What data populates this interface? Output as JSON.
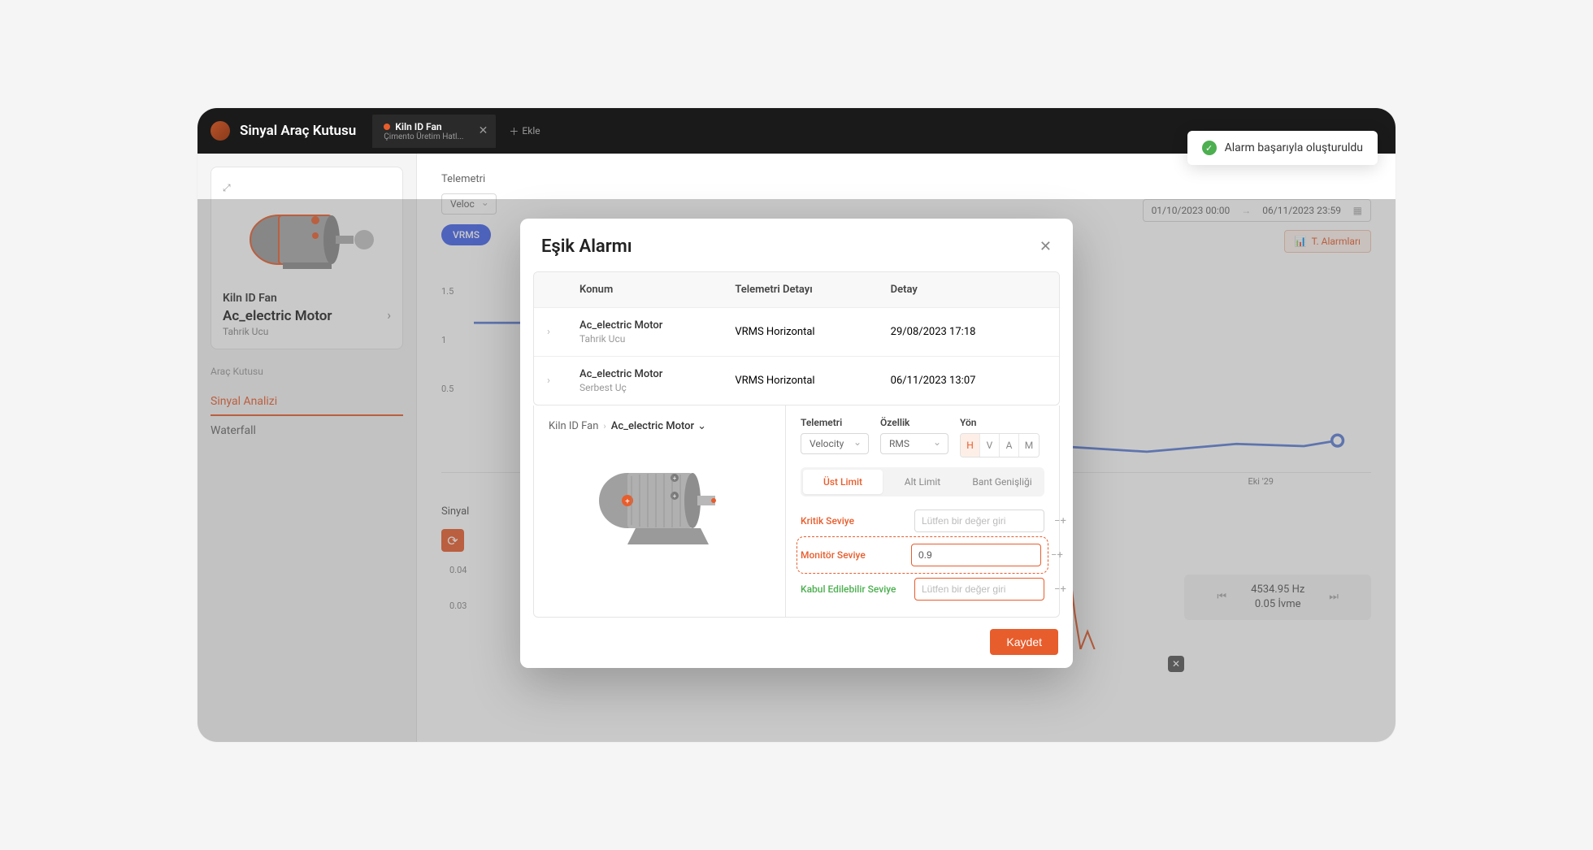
{
  "app": {
    "title": "Sinyal Araç Kutusu"
  },
  "tab": {
    "title": "Kiln ID Fan",
    "subtitle": "Çimento Üretim Hatl...",
    "add_label": "Ekle"
  },
  "toast": {
    "text": "Alarm başarıyla oluşturuldu"
  },
  "sidebar": {
    "card": {
      "line1": "Kiln ID Fan",
      "line2": "Ac_electric Motor",
      "line3": "Tahrik Ucu"
    },
    "section_label": "Araç Kutusu",
    "nav": {
      "signal_analysis": "Sinyal Analizi",
      "waterfall": "Waterfall"
    }
  },
  "content": {
    "telemetry_label": "Telemetri",
    "telemetry_select": "Veloc",
    "vrms_chip": "VRMS",
    "daterange": {
      "from": "01/10/2023 00:00",
      "to": "06/11/2023 23:59"
    },
    "alarms_btn": "T. Alarmları",
    "y_ticks": [
      "1.5",
      "1",
      "0.5"
    ],
    "x_tick": "Eki '29",
    "signal_label": "Sinyal",
    "chart2_y": [
      "0.04",
      "0.03"
    ],
    "freq": {
      "hz": "4534.95 Hz",
      "ivme": "0.05 İvme"
    }
  },
  "modal": {
    "title": "Eşik Alarmı",
    "th": {
      "konum": "Konum",
      "telemetri": "Telemetri Detayı",
      "detay": "Detay"
    },
    "rows": [
      {
        "name": "Ac_electric Motor",
        "sub": "Tahrik Ucu",
        "tel": "VRMS Horizontal",
        "date": "29/08/2023 17:18"
      },
      {
        "name": "Ac_electric Motor",
        "sub": "Serbest Uç",
        "tel": "VRMS Horizontal",
        "date": "06/11/2023 13:07"
      }
    ],
    "crumb": {
      "root": "Kiln ID Fan",
      "leaf": "Ac_electric Motor"
    },
    "config": {
      "telemetri_label": "Telemetri",
      "telemetri_value": "Velocity",
      "ozellik_label": "Özellik",
      "ozellik_value": "RMS",
      "yon_label": "Yön",
      "yon": {
        "h": "H",
        "v": "V",
        "a": "A",
        "m": "M"
      },
      "limits": {
        "ust": "Üst Limit",
        "alt": "Alt Limit",
        "bant": "Bant Genişliği"
      },
      "levels": {
        "kritik": "Kritik Seviye",
        "monitor": "Monitör Seviye",
        "kabul": "Kabul Edilebilir Seviye"
      },
      "placeholder": "Lütfen bir değer giri",
      "monitor_value": "0.9"
    },
    "save": "Kaydet"
  }
}
